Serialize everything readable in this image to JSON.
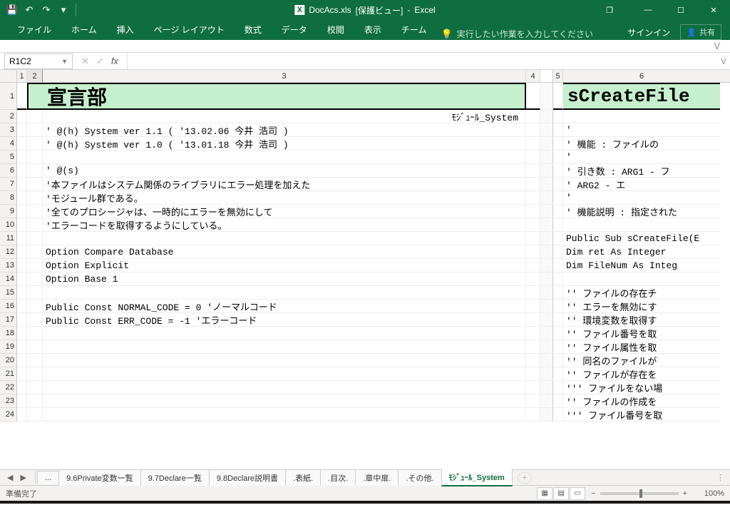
{
  "title": {
    "filename": "DocAcs.xls",
    "mode": "[保護ビュー]",
    "app": "Excel"
  },
  "qat": {
    "save": "💾",
    "undo": "↶",
    "redo": "↷"
  },
  "win": {
    "restore": "❐",
    "min": "—",
    "max": "☐",
    "close": "✕"
  },
  "tabs": {
    "file": "ファイル",
    "home": "ホーム",
    "insert": "挿入",
    "layout": "ページ レイアウト",
    "formulas": "数式",
    "data": "データ",
    "review": "校閲",
    "view": "表示",
    "team": "チーム"
  },
  "tellme": "実行したい作業を入力してください",
  "signin": "サインイン",
  "share": "共有",
  "namebox": "R1C2",
  "fx": "fx",
  "cols": {
    "c1": "1",
    "c2": "2",
    "c3": "3",
    "c4": "4",
    "c5": "5",
    "c6": "6"
  },
  "rowheads": [
    "1",
    "2",
    "3",
    "4",
    "5",
    "6",
    "7",
    "8",
    "9",
    "10",
    "11",
    "12",
    "13",
    "14",
    "15",
    "16",
    "17",
    "18",
    "19",
    "20",
    "21",
    "22",
    "23",
    "24"
  ],
  "header_left": "宣言部",
  "header_right": "sCreateFile",
  "module_label": "ﾓｼﾞｭｰﾙ_System",
  "left": {
    "r3": "' @(h) System            ver 1.1 ( '13.02.06 今井 浩司 )",
    "r4": "' @(h) System            ver 1.0 ( '13.01.18 今井 浩司 )",
    "r6": "' @(s)",
    "r7": "'本ファイルはシステム関係のライブラリにエラー処理を加えた",
    "r8": "'モジュール群である。",
    "r9": "'全てのプロシージャは、一時的にエラーを無効にして",
    "r10": "'エラーコードを取得するようにしている。",
    "r12": "Option Compare Database",
    "r13": "Option Explicit",
    "r14": "Option Base 1",
    "r16": "Public Const NORMAL_CODE = 0   'ノーマルコード",
    "r17": "Public Const ERR_CODE = -1  'エラーコード"
  },
  "right": {
    "r3": "'",
    "r4": "' 機能     : ファイルの",
    "r5": "'",
    "r6": "' 引き数   : ARG1 - フ",
    "r7": "'            ARG2 - エ",
    "r8": "'",
    "r9": "' 機能説明  : 指定された",
    "r11": "Public Sub sCreateFile(E",
    "r12": "    Dim ret As Integer",
    "r13": "    Dim FileNum As Integ",
    "r15": "    '' ファイルの存在チ",
    "r16": "    '' エラーを無効にす",
    "r17": "    '' 環境変数を取得す",
    "r18": "    '' ファイル番号を取",
    "r19": "    '' ファイル属性を取",
    "r20": "    '' 同名のファイルが",
    "r21": "    '' ファイルが存在を",
    "r22": "    ''' ファイルをない場",
    "r23": "    '' ファイルの作成を",
    "r24": "    ''' ファイル番号を取"
  },
  "sheets": {
    "more": "...",
    "s1": "9.6Private変数一覧",
    "s2": "9.7Declare一覧",
    "s3": "9.8Declare説明書",
    "s4": ".表紙.",
    "s5": ".目次.",
    "s6": ".章中扉.",
    "s7": ".その他.",
    "active": "ﾓｼﾞｭｰﾙ_System"
  },
  "status": {
    "ready": "準備完了",
    "zoom": "100%"
  }
}
